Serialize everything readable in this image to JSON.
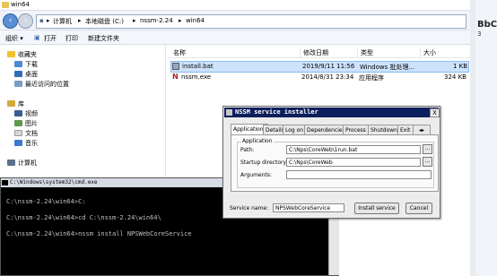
{
  "explorer": {
    "window_title": "win64",
    "address_segments": [
      "计算机",
      "本地磁盘 (C:)",
      "nssm-2.24",
      "win64"
    ],
    "toolbar": {
      "organize": "组织 ▾",
      "open": "打开",
      "print": "打印",
      "new_folder": "新建文件夹"
    },
    "nav": {
      "favorites": "收藏夹",
      "downloads": "下载",
      "desktop": "桌面",
      "recent": "最近访问的位置",
      "libraries": "库",
      "videos": "视频",
      "pictures": "图片",
      "documents": "文档",
      "music": "音乐",
      "computer": "计算机"
    },
    "columns": {
      "name": "名称",
      "modified": "修改日期",
      "type": "类型",
      "size": "大小"
    },
    "files": [
      {
        "name": "install.bat",
        "modified": "2019/9/11 11:56",
        "type": "Windows 批处理...",
        "size": "1 KB"
      },
      {
        "name": "nssm.exe",
        "modified": "2014/8/31 23:34",
        "type": "应用程序",
        "size": "324 KB"
      }
    ]
  },
  "side_panel": {
    "heading": "BbC",
    "count": "3"
  },
  "cmd": {
    "title": "C:\\Windows\\system32\\cmd.exe",
    "lines": [
      "C:\\nssm-2.24\\win64>C:",
      "C:\\nssm-2.24\\win64>cd C:\\nssm-2.24\\win64\\",
      "C:\\nssm-2.24\\win64>nssm install NPSWebCoreService"
    ]
  },
  "nssm": {
    "title": "NSSM service installer",
    "close": "X",
    "tabs": [
      "Application",
      "Details",
      "Log on",
      "Dependencies",
      "Process",
      "Shutdown",
      "Exit"
    ],
    "tab_scroll": "◂▸",
    "group_label": "Application",
    "path_label": "Path:",
    "path_value": "C:\\Nps\\CoreWeb\\1run.bat",
    "startup_label": "Startup directory:",
    "startup_value": "C:\\Nps\\CoreWeb",
    "args_label": "Arguments:",
    "args_value": "",
    "browse": "...",
    "service_name_label": "Service name:",
    "service_name_value": "NPSWebCoreService",
    "install_button": "Install service",
    "cancel_button": "Cancel"
  }
}
